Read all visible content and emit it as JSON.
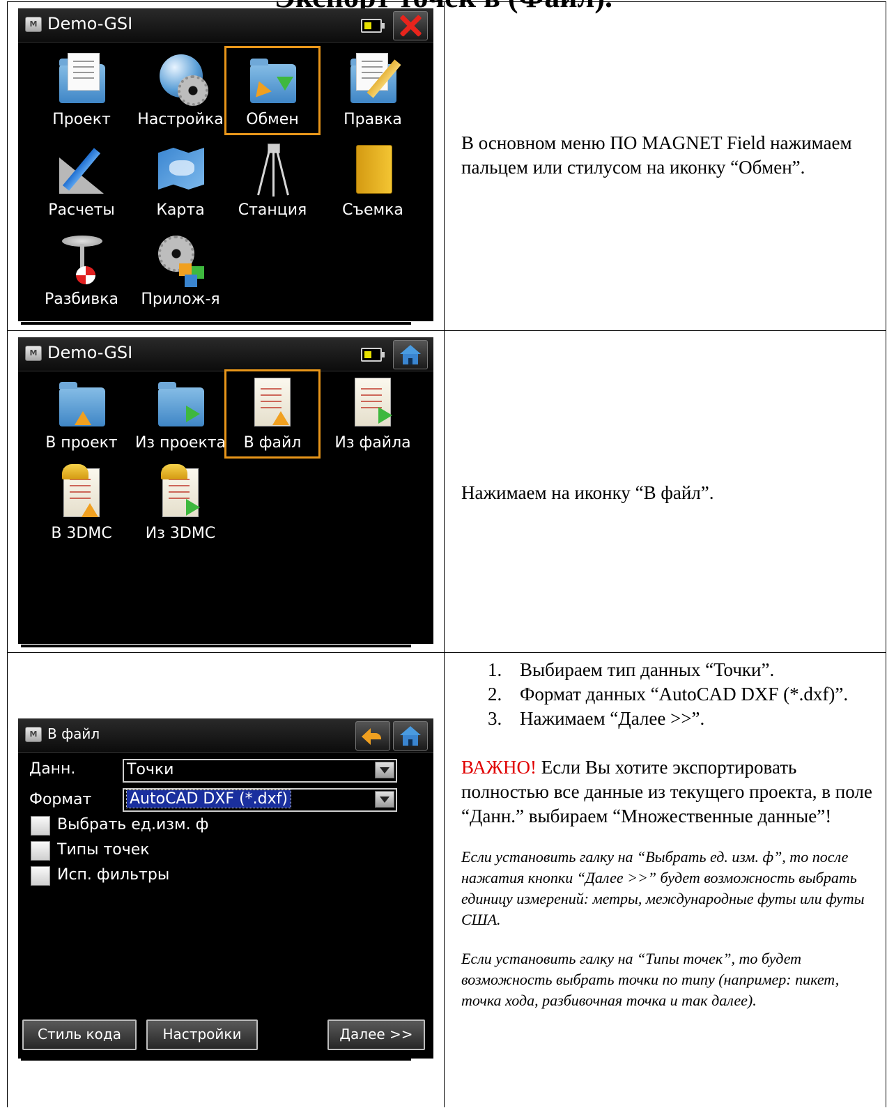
{
  "page_title": "Экспорт точек в (Файл).",
  "rows": [
    {
      "screen": {
        "title": "Demo-GSI",
        "tiles": [
          {
            "label": "Проект",
            "icon": "document-folder-icon"
          },
          {
            "label": "Настройка",
            "icon": "globe-gear-icon"
          },
          {
            "label": "Обмен",
            "icon": "exchange-folder-icon",
            "selected": true
          },
          {
            "label": "Правка",
            "icon": "edit-document-icon"
          },
          {
            "label": "Расчеты",
            "icon": "calc-ruler-icon"
          },
          {
            "label": "Карта",
            "icon": "map-icon"
          },
          {
            "label": "Станция",
            "icon": "tripod-icon"
          },
          {
            "label": "Съемка",
            "icon": "notebook-icon"
          },
          {
            "label": "Разбивка",
            "icon": "stakeout-pin-icon"
          },
          {
            "label": "Прилож-я",
            "icon": "apps-gear-icon"
          }
        ],
        "close_icon": "close-x-icon"
      },
      "text": "В основном меню ПО MAGNET Field нажимаем пальцем или стилусом на иконку “Обмен”."
    },
    {
      "screen": {
        "title": "Demo-GSI",
        "tiles": [
          {
            "label": "В проект",
            "icon": "folder-import-icon"
          },
          {
            "label": "Из проекта",
            "icon": "folder-export-icon"
          },
          {
            "label": "В файл",
            "icon": "file-import-icon",
            "selected": true
          },
          {
            "label": "Из файла",
            "icon": "file-export-icon"
          },
          {
            "label": "В 3DMC",
            "icon": "3dmc-import-icon"
          },
          {
            "label": "Из 3DMC",
            "icon": "3dmc-export-icon"
          }
        ],
        "home_icon": "home-icon"
      },
      "text": "Нажимаем на иконку “В файл”."
    },
    {
      "screen": {
        "title": "В файл",
        "data_label": "Данн.",
        "data_value": "Точки",
        "format_label": "Формат",
        "format_value": "AutoCAD DXF (*.dxf)",
        "checkboxes": [
          "Выбрать ед.изм. ф",
          "Типы точек",
          "Исп. фильтры"
        ],
        "buttons": {
          "code_style": "Стиль кода",
          "settings": "Настройки",
          "next": "Далее >>"
        }
      },
      "steps": [
        "Выбираем тип данных “Точки”.",
        "Формат данных “AutoCAD DXF (*.dxf)”.",
        "Нажимаем “Далее >>”."
      ],
      "important_label": "ВАЖНО!",
      "important_text": " Если Вы хотите экспортировать полностью все данные из текущего проекта, в поле “Данн.” выбираем “Множественные данные”!",
      "note1": "Если установить галку на “Выбрать ед. изм. ф”, то после нажатия кнопки “Далее >>” будет возможность выбрать единицу измерений: метры, международные футы или футы США.",
      "note2": "Если установить галку на “Типы точек”, то будет возможность выбрать точки по типу (например: пикет, точка хода, разбивочная точка и так далее)."
    }
  ],
  "colors": {
    "selection": "#e8961a",
    "important": "#e00000",
    "highlight": "#1a2f9e"
  }
}
